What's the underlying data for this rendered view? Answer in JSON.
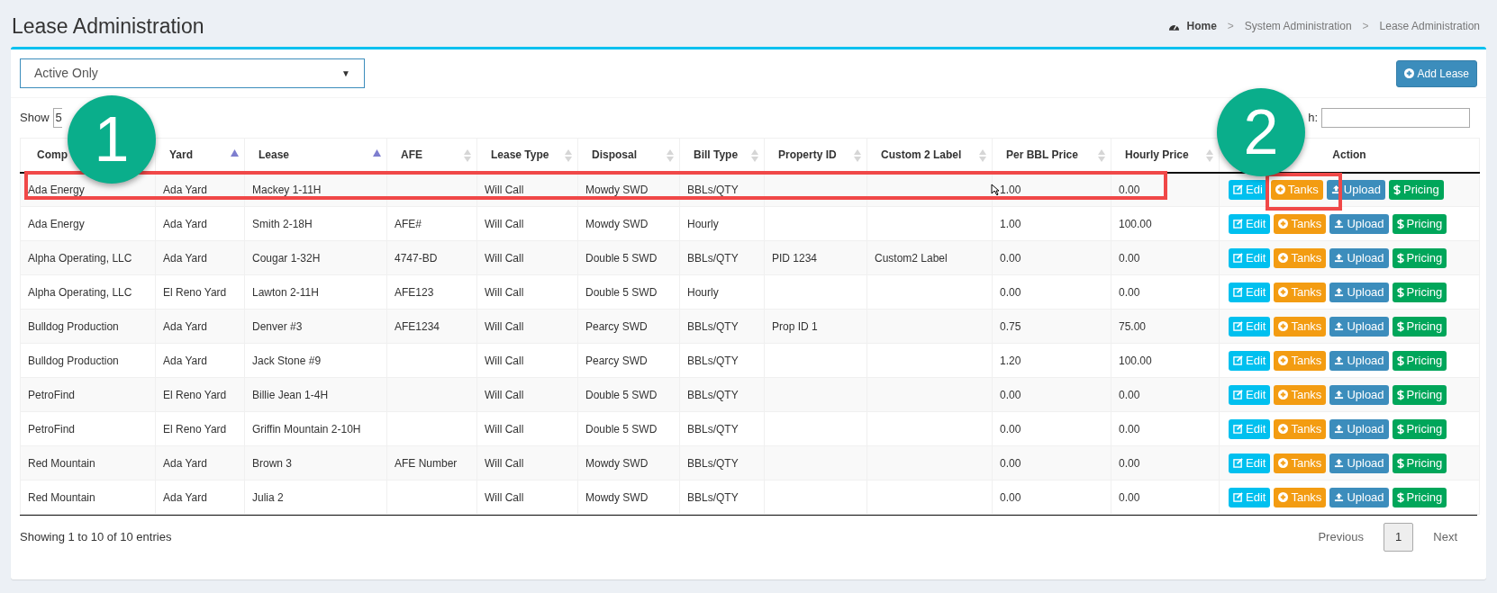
{
  "page_title": "Lease Administration",
  "breadcrumb": [
    {
      "label": "Home",
      "kind": "home"
    },
    {
      "separator": ">",
      "label": "System Administration",
      "kind": "link"
    },
    {
      "separator": ">",
      "label": "Lease Administration",
      "kind": "current"
    }
  ],
  "filter": {
    "value": "Active Only",
    "caret": "▼"
  },
  "add_button": "Add Lease",
  "length": {
    "label": "Show",
    "value": "5"
  },
  "search": {
    "label": "h:"
  },
  "columns": [
    {
      "label": "Comp"
    },
    {
      "label": "Yard",
      "sortable": true,
      "sorted": true
    },
    {
      "label": "Lease",
      "sortable": true,
      "sorted": true
    },
    {
      "label": "AFE",
      "sortable": true,
      "sorted": false
    },
    {
      "label": "Lease Type",
      "sortable": true,
      "sorted": false
    },
    {
      "label": "Disposal",
      "sortable": true,
      "sorted": false
    },
    {
      "label": "Bill Type",
      "sortable": true,
      "sorted": false
    },
    {
      "label": "Property ID",
      "sortable": true,
      "sorted": false
    },
    {
      "label": "Custom 2 Label",
      "sortable": true,
      "sorted": false
    },
    {
      "label": "Per BBL Price",
      "sortable": true,
      "sorted": false
    },
    {
      "label": "Hourly Price",
      "sortable": true,
      "sorted": false
    },
    {
      "label": "Action"
    }
  ],
  "rows": [
    {
      "cells": [
        "Ada Energy",
        "Ada Yard",
        "Mackey 1-11H",
        "",
        "Will Call",
        "Mowdy SWD",
        "BBLs/QTY",
        "",
        "",
        "1.00",
        "0.00"
      ],
      "buttons": [
        "Edi",
        "Tanks",
        "Upload",
        "Pricing"
      ]
    },
    {
      "cells": [
        "Ada Energy",
        "Ada Yard",
        "Smith 2-18H",
        "AFE#",
        "Will Call",
        "Mowdy SWD",
        "Hourly",
        "",
        "",
        "1.00",
        "100.00"
      ],
      "buttons": [
        "Edit",
        "Tanks",
        "Upload",
        "Pricing"
      ]
    },
    {
      "cells": [
        "Alpha Operating, LLC",
        "Ada Yard",
        "Cougar 1-32H",
        "4747-BD",
        "Will Call",
        "Double 5 SWD",
        "BBLs/QTY",
        "PID 1234",
        "Custom2 Label",
        "0.00",
        "0.00"
      ],
      "buttons": [
        "Edit",
        "Tanks",
        "Upload",
        "Pricing"
      ]
    },
    {
      "cells": [
        "Alpha Operating, LLC",
        "El Reno Yard",
        "Lawton 2-11H",
        "AFE123",
        "Will Call",
        "Double 5 SWD",
        "Hourly",
        "",
        "",
        "0.00",
        "0.00"
      ],
      "buttons": [
        "Edit",
        "Tanks",
        "Upload",
        "Pricing"
      ]
    },
    {
      "cells": [
        "Bulldog Production",
        "Ada Yard",
        "Denver #3",
        "AFE1234",
        "Will Call",
        "Pearcy SWD",
        "BBLs/QTY",
        "Prop ID 1",
        "",
        "0.75",
        "75.00"
      ],
      "buttons": [
        "Edit",
        "Tanks",
        "Upload",
        "Pricing"
      ]
    },
    {
      "cells": [
        "Bulldog Production",
        "Ada Yard",
        "Jack Stone #9",
        "",
        "Will Call",
        "Pearcy SWD",
        "BBLs/QTY",
        "",
        "",
        "1.20",
        "100.00"
      ],
      "buttons": [
        "Edit",
        "Tanks",
        "Upload",
        "Pricing"
      ]
    },
    {
      "cells": [
        "PetroFind",
        "El Reno Yard",
        "Billie Jean 1-4H",
        "",
        "Will Call",
        "Double 5 SWD",
        "BBLs/QTY",
        "",
        "",
        "0.00",
        "0.00"
      ],
      "buttons": [
        "Edit",
        "Tanks",
        "Upload",
        "Pricing"
      ]
    },
    {
      "cells": [
        "PetroFind",
        "El Reno Yard",
        "Griffin Mountain 2-10H",
        "",
        "Will Call",
        "Double 5 SWD",
        "BBLs/QTY",
        "",
        "",
        "0.00",
        "0.00"
      ],
      "buttons": [
        "Edit",
        "Tanks",
        "Upload",
        "Pricing"
      ]
    },
    {
      "cells": [
        "Red Mountain",
        "Ada Yard",
        "Brown 3",
        "AFE Number",
        "Will Call",
        "Mowdy SWD",
        "BBLs/QTY",
        "",
        "",
        "0.00",
        "0.00"
      ],
      "buttons": [
        "Edit",
        "Tanks",
        "Upload",
        "Pricing"
      ]
    },
    {
      "cells": [
        "Red Mountain",
        "Ada Yard",
        "Julia 2",
        "",
        "Will Call",
        "Mowdy SWD",
        "BBLs/QTY",
        "",
        "",
        "0.00",
        "0.00"
      ],
      "buttons": [
        "Edit",
        "Tanks",
        "Upload",
        "Pricing"
      ]
    }
  ],
  "info": "Showing 1 to 10 of 10 entries",
  "pagination": [
    {
      "label": "Previous",
      "selected": false
    },
    {
      "label": "1",
      "selected": true
    },
    {
      "label": "Next",
      "selected": false
    }
  ],
  "callouts": [
    {
      "number": "1"
    },
    {
      "number": "2"
    }
  ]
}
